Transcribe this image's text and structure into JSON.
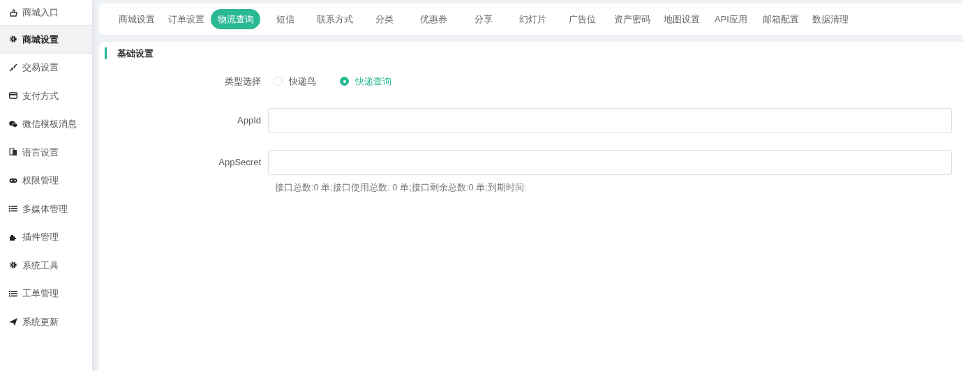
{
  "sidebar": {
    "items": [
      {
        "label": "商城入口",
        "selected": false
      },
      {
        "label": "商城设置",
        "selected": true
      },
      {
        "label": "交易设置",
        "selected": false
      },
      {
        "label": "支付方式",
        "selected": false
      },
      {
        "label": "微信模板消息",
        "selected": false
      },
      {
        "label": "语言设置",
        "selected": false
      },
      {
        "label": "权限管理",
        "selected": false
      },
      {
        "label": "多媒体管理",
        "selected": false
      },
      {
        "label": "插件管理",
        "selected": false
      },
      {
        "label": "系统工具",
        "selected": false
      },
      {
        "label": "工单管理",
        "selected": false
      },
      {
        "label": "系统更新",
        "selected": false
      }
    ]
  },
  "tabs": [
    {
      "label": "商城设置",
      "selected": false
    },
    {
      "label": "订单设置",
      "selected": false
    },
    {
      "label": "物流查询",
      "selected": true
    },
    {
      "label": "短信",
      "selected": false
    },
    {
      "label": "联系方式",
      "selected": false
    },
    {
      "label": "分类",
      "selected": false
    },
    {
      "label": "优惠券",
      "selected": false
    },
    {
      "label": "分享",
      "selected": false
    },
    {
      "label": "幻灯片",
      "selected": false
    },
    {
      "label": "广告位",
      "selected": false
    },
    {
      "label": "资产密码",
      "selected": false
    },
    {
      "label": "地图设置",
      "selected": false
    },
    {
      "label": "API应用",
      "selected": false
    },
    {
      "label": "邮箱配置",
      "selected": false
    },
    {
      "label": "数据清理",
      "selected": false
    }
  ],
  "section_title": "基础设置",
  "type_select": {
    "label": "类型选择",
    "options": [
      {
        "label": "快递鸟",
        "selected": false
      },
      {
        "label": "快递查询",
        "selected": true
      }
    ]
  },
  "fields": [
    {
      "label": "AppId"
    },
    {
      "label": "AppSecret"
    }
  ],
  "usage_note": "接口总数:0 单;接口使用总数: 0 单;接口剩余总数:0 单;到期时间:"
}
